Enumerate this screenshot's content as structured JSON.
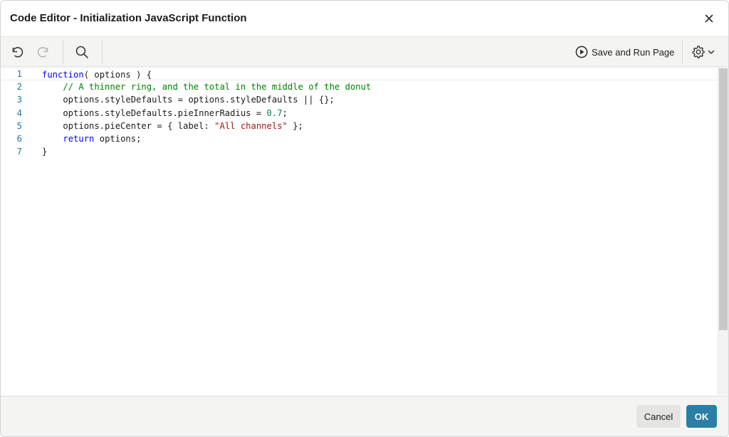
{
  "dialog": {
    "title": "Code Editor - Initialization JavaScript Function"
  },
  "icons": {
    "close": "close-icon",
    "undo": "undo-icon",
    "redo": "redo-icon",
    "search": "search-icon",
    "run": "play-circle-icon",
    "settings": "gear-icon",
    "chevron": "chevron-down-icon"
  },
  "toolbar": {
    "save_run_label": "Save and Run Page",
    "redo_enabled": false
  },
  "editor": {
    "current_line": 1,
    "lines": [
      {
        "number": "1",
        "tokens": [
          {
            "t": "kw",
            "v": "function"
          },
          {
            "t": "tx",
            "v": "( options ) {"
          }
        ]
      },
      {
        "number": "2",
        "tokens": [
          {
            "t": "tx",
            "v": "    "
          },
          {
            "t": "cm",
            "v": "// A thinner ring, and the total in the middle of the donut"
          }
        ]
      },
      {
        "number": "3",
        "tokens": [
          {
            "t": "tx",
            "v": "    options.styleDefaults = options.styleDefaults || {};"
          }
        ]
      },
      {
        "number": "4",
        "tokens": [
          {
            "t": "tx",
            "v": "    options.styleDefaults.pieInnerRadius = "
          },
          {
            "t": "nm",
            "v": "0.7"
          },
          {
            "t": "tx",
            "v": ";"
          }
        ]
      },
      {
        "number": "5",
        "tokens": [
          {
            "t": "tx",
            "v": "    options.pieCenter = { label: "
          },
          {
            "t": "str",
            "v": "\"All channels\""
          },
          {
            "t": "tx",
            "v": " };"
          }
        ]
      },
      {
        "number": "6",
        "tokens": [
          {
            "t": "tx",
            "v": "    "
          },
          {
            "t": "kw",
            "v": "return"
          },
          {
            "t": "tx",
            "v": " options;"
          }
        ]
      },
      {
        "number": "7",
        "tokens": [
          {
            "t": "tx",
            "v": "}"
          }
        ]
      }
    ]
  },
  "footer": {
    "cancel_label": "Cancel",
    "ok_label": "OK"
  },
  "colors": {
    "keyword": "#0000ff",
    "comment": "#008000",
    "number": "#098658",
    "string": "#a31515",
    "line_number": "#237893",
    "ok_button": "#2b7fa6"
  }
}
